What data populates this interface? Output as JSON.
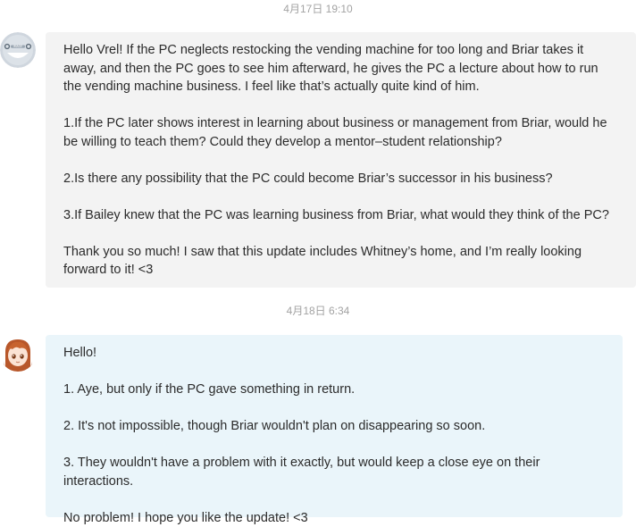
{
  "messages": [
    {
      "timestamp": "4月17日 19:10",
      "sender_avatar": "user-avatar-logo",
      "paragraphs": [
        "Hello Vrel! If the PC neglects restocking the vending machine for too long and Briar takes it away, and then the PC goes to see him afterward, he gives the PC a lecture about how to run the vending machine business. I feel like that’s actually quite kind of him.",
        "1.If the PC later shows interest in learning about business or management from Briar, would he be willing to teach them? Could they develop a mentor–student relationship?",
        "2.Is there any possibility that the PC could become Briar’s successor in his business?",
        "3.If Bailey knew that the PC was learning business from Briar, what would they think of the PC?",
        "Thank you so much! I saw that this update includes Whitney’s home, and I’m really looking forward to it! <3"
      ]
    },
    {
      "timestamp": "4月18日 6:34",
      "sender_avatar": "anime-character-avatar",
      "paragraphs": [
        "Hello!",
        "1. Aye, but only if the PC gave something in return.",
        "2. It's not impossible, though Briar wouldn't plan on disappearing so soon.",
        "3. They wouldn't have a problem with it exactly, but would keep a close eye on their interactions.",
        "No problem! I hope you like the update! <3"
      ]
    }
  ],
  "colors": {
    "timestamp": "#a3a3a3",
    "bubble_incoming": "#f3f3f3",
    "bubble_reply": "#eaf5fa",
    "text": "#2b2b2b"
  }
}
